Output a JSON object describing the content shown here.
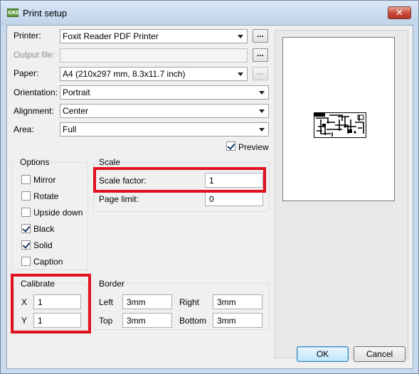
{
  "window": {
    "title": "Print setup",
    "app_icon_text": "GRD",
    "close_glyph": "✕"
  },
  "printer": {
    "label": "Printer:",
    "value": "Foxit Reader PDF Printer",
    "browse": "..."
  },
  "output_file": {
    "label": "Output file:",
    "value": "",
    "browse": "..."
  },
  "paper": {
    "label": "Paper:",
    "value": "A4 (210x297 mm, 8.3x11.7 inch)",
    "browse": "..."
  },
  "orientation": {
    "label": "Orientation:",
    "value": "Portrait"
  },
  "alignment": {
    "label": "Alignment:",
    "value": "Center"
  },
  "area": {
    "label": "Area:",
    "value": "Full"
  },
  "preview_toggle": {
    "label": "Preview",
    "checked": true
  },
  "options": {
    "title": "Options",
    "items": [
      {
        "label": "Mirror",
        "checked": false
      },
      {
        "label": "Rotate",
        "checked": false
      },
      {
        "label": "Upside down",
        "checked": false
      },
      {
        "label": "Black",
        "checked": true
      },
      {
        "label": "Solid",
        "checked": true
      },
      {
        "label": "Caption",
        "checked": false
      }
    ]
  },
  "scale": {
    "title": "Scale",
    "factor_label": "Scale factor:",
    "factor_value": "1",
    "limit_label": "Page limit:",
    "limit_value": "0"
  },
  "calibrate": {
    "title": "Calibrate",
    "x_label": "X",
    "x_value": "1",
    "y_label": "Y",
    "y_value": "1"
  },
  "border": {
    "title": "Border",
    "left_label": "Left",
    "left_value": "3mm",
    "right_label": "Right",
    "right_value": "3mm",
    "top_label": "Top",
    "top_value": "3mm",
    "bottom_label": "Bottom",
    "bottom_value": "3mm"
  },
  "buttons": {
    "ok": "OK",
    "cancel": "Cancel"
  },
  "colors": {
    "highlight": "#e0101e",
    "titlebar": "#c9daee",
    "dialog_bg": "#f0f0f0"
  }
}
